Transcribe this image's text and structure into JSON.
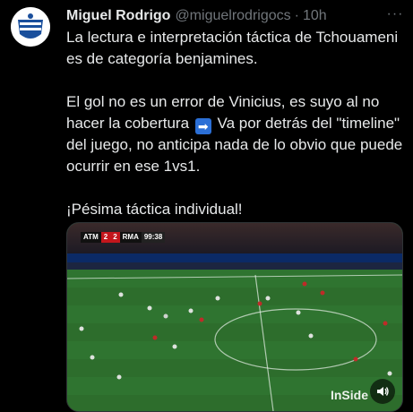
{
  "tweet": {
    "author_name": "Miguel Rodrigo",
    "handle": "@miguelrodrigocs",
    "separator": "·",
    "time": "10h",
    "more_label": "···",
    "paragraphs": {
      "p1": "La lectura e interpretación táctica de Tchouameni es de categoría benjamines.",
      "p2_before": "El gol no es un error de Vinicius, es suyo al no hacer la cobertura",
      "p2_emoji": "➡",
      "p2_after": "Va por detrás del \"timeline\" del juego, no anticipa nada de lo obvio que puede ocurrir en ese 1vs1.",
      "p3": "¡Pésima táctica individual!"
    }
  },
  "media": {
    "scoreboard": {
      "home": "ATM",
      "home_score": "2",
      "away_score": "2",
      "away": "RMA",
      "clock": "99:38"
    },
    "watermark": "InSide",
    "sound_icon": "speaker-icon"
  },
  "colors": {
    "background": "#000000",
    "text": "#e7e9ea",
    "secondary_text": "#71767b",
    "pitch": "#2d6d2c"
  }
}
